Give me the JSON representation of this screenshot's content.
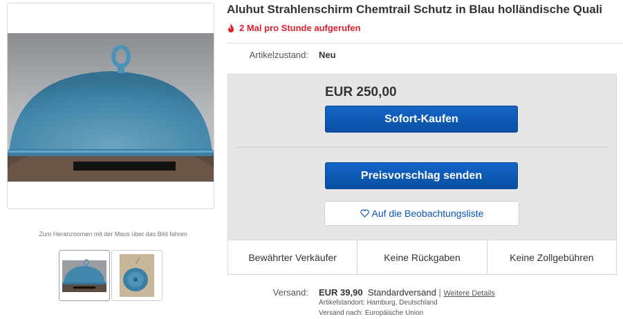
{
  "item": {
    "title": "Aluhut Strahlenschirm Chemtrail Schutz in Blau holländische Quali",
    "views": "2 Mal pro Stunde aufgerufen",
    "condition_label": "Artikelzustand:",
    "condition_value": "Neu"
  },
  "gallery": {
    "zoom_hint": "Zum Heranzoomen mit der Maus über das Bild fahren",
    "thumbnail_count": 2
  },
  "buy": {
    "price": "EUR 250,00",
    "buy_now_label": "Sofort-Kaufen",
    "offer_label": "Preisvorschlag senden",
    "watch_label": "Auf die Beobachtungsliste",
    "accent_color": "#0a56b4"
  },
  "badges": [
    "Bewährter Verkäufer",
    "Keine Rückgaben",
    "Keine Zollgebühren"
  ],
  "shipping": {
    "label": "Versand:",
    "price": "EUR 39,90",
    "method": "Standardversand",
    "separator": "|",
    "details_link": "Weitere Details",
    "location": "Artikelstandort:  Hamburg, Deutschland",
    "ships_to": "Versand nach:  Europäische Union"
  },
  "colors": {
    "views_red": "#dd1e31",
    "link_blue": "#0654ba"
  }
}
